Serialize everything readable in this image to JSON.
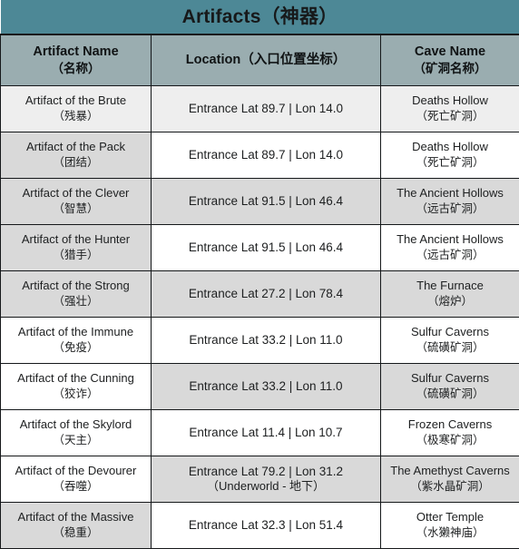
{
  "title": {
    "text": "Artifacts（神器）",
    "background_color": "#4d8896"
  },
  "columns": [
    {
      "key": "artifact_name",
      "label_en": "Artifact Name",
      "label_zh": "（名称）"
    },
    {
      "key": "location",
      "label_en": "Location（入口位置坐标）",
      "label_zh": ""
    },
    {
      "key": "cave_name",
      "label_en": "Cave Name",
      "label_zh": "（矿洞名称）"
    }
  ],
  "header_background_color": "#9aadb0",
  "row_shading": {
    "gray": "#d9d9d9",
    "white": "#ffffff",
    "light": "#eeeeee"
  },
  "rows": [
    {
      "artifact_en": "Artifact of the Brute",
      "artifact_zh": "（残暴）",
      "location_en": "Entrance Lat 89.7 | Lon 14.0",
      "location_zh": "",
      "cave_en": "Deaths Hollow",
      "cave_zh": "（死亡矿洞）",
      "name_bg": "light",
      "data_bg": "light"
    },
    {
      "artifact_en": "Artifact of the Pack",
      "artifact_zh": "（团结）",
      "location_en": "Entrance Lat 89.7 | Lon 14.0",
      "location_zh": "",
      "cave_en": "Deaths Hollow",
      "cave_zh": "（死亡矿洞）",
      "name_bg": "gray",
      "data_bg": "white"
    },
    {
      "artifact_en": "Artifact of the Clever",
      "artifact_zh": "（智慧）",
      "location_en": "Entrance Lat 91.5 | Lon 46.4",
      "location_zh": "",
      "cave_en": "The Ancient Hollows",
      "cave_zh": "（远古矿洞）",
      "name_bg": "gray",
      "data_bg": "gray"
    },
    {
      "artifact_en": "Artifact of the Hunter",
      "artifact_zh": "（猎手）",
      "location_en": "Entrance Lat 91.5 | Lon 46.4",
      "location_zh": "",
      "cave_en": "The Ancient Hollows",
      "cave_zh": "（远古矿洞）",
      "name_bg": "gray",
      "data_bg": "white"
    },
    {
      "artifact_en": "Artifact of the Strong",
      "artifact_zh": "（强壮）",
      "location_en": "Entrance Lat 27.2 | Lon 78.4",
      "location_zh": "",
      "cave_en": "The Furnace",
      "cave_zh": "（熔炉）",
      "name_bg": "gray",
      "data_bg": "gray"
    },
    {
      "artifact_en": "Artifact of the Immune",
      "artifact_zh": "（免疫）",
      "location_en": "Entrance Lat 33.2 | Lon 11.0",
      "location_zh": "",
      "cave_en": "Sulfur Caverns",
      "cave_zh": "（硫磺矿洞）",
      "name_bg": "white",
      "data_bg": "white"
    },
    {
      "artifact_en": "Artifact of the Cunning",
      "artifact_zh": "（狡诈）",
      "location_en": "Entrance Lat 33.2 | Lon 11.0",
      "location_zh": "",
      "cave_en": "Sulfur Caverns",
      "cave_zh": "（硫磺矿洞）",
      "name_bg": "white",
      "data_bg": "gray"
    },
    {
      "artifact_en": "Artifact of the Skylord",
      "artifact_zh": "（天主）",
      "location_en": "Entrance Lat 11.4 | Lon 10.7",
      "location_zh": "",
      "cave_en": "Frozen Caverns",
      "cave_zh": "（极寒矿洞）",
      "name_bg": "white",
      "data_bg": "white"
    },
    {
      "artifact_en": "Artifact of the Devourer",
      "artifact_zh": "（吞噬）",
      "location_en": "Entrance Lat 79.2 | Lon 31.2",
      "location_zh": "（Underworld - 地下）",
      "cave_en": "The Amethyst Caverns",
      "cave_zh": "（紫水晶矿洞）",
      "name_bg": "white",
      "data_bg": "gray"
    },
    {
      "artifact_en": "Artifact of the Massive",
      "artifact_zh": "（稳重）",
      "location_en": "Entrance Lat 32.3 | Lon 51.4",
      "location_zh": "",
      "cave_en": "Otter Temple",
      "cave_zh": "（水獭神庙）",
      "name_bg": "gray",
      "data_bg": "white"
    }
  ]
}
